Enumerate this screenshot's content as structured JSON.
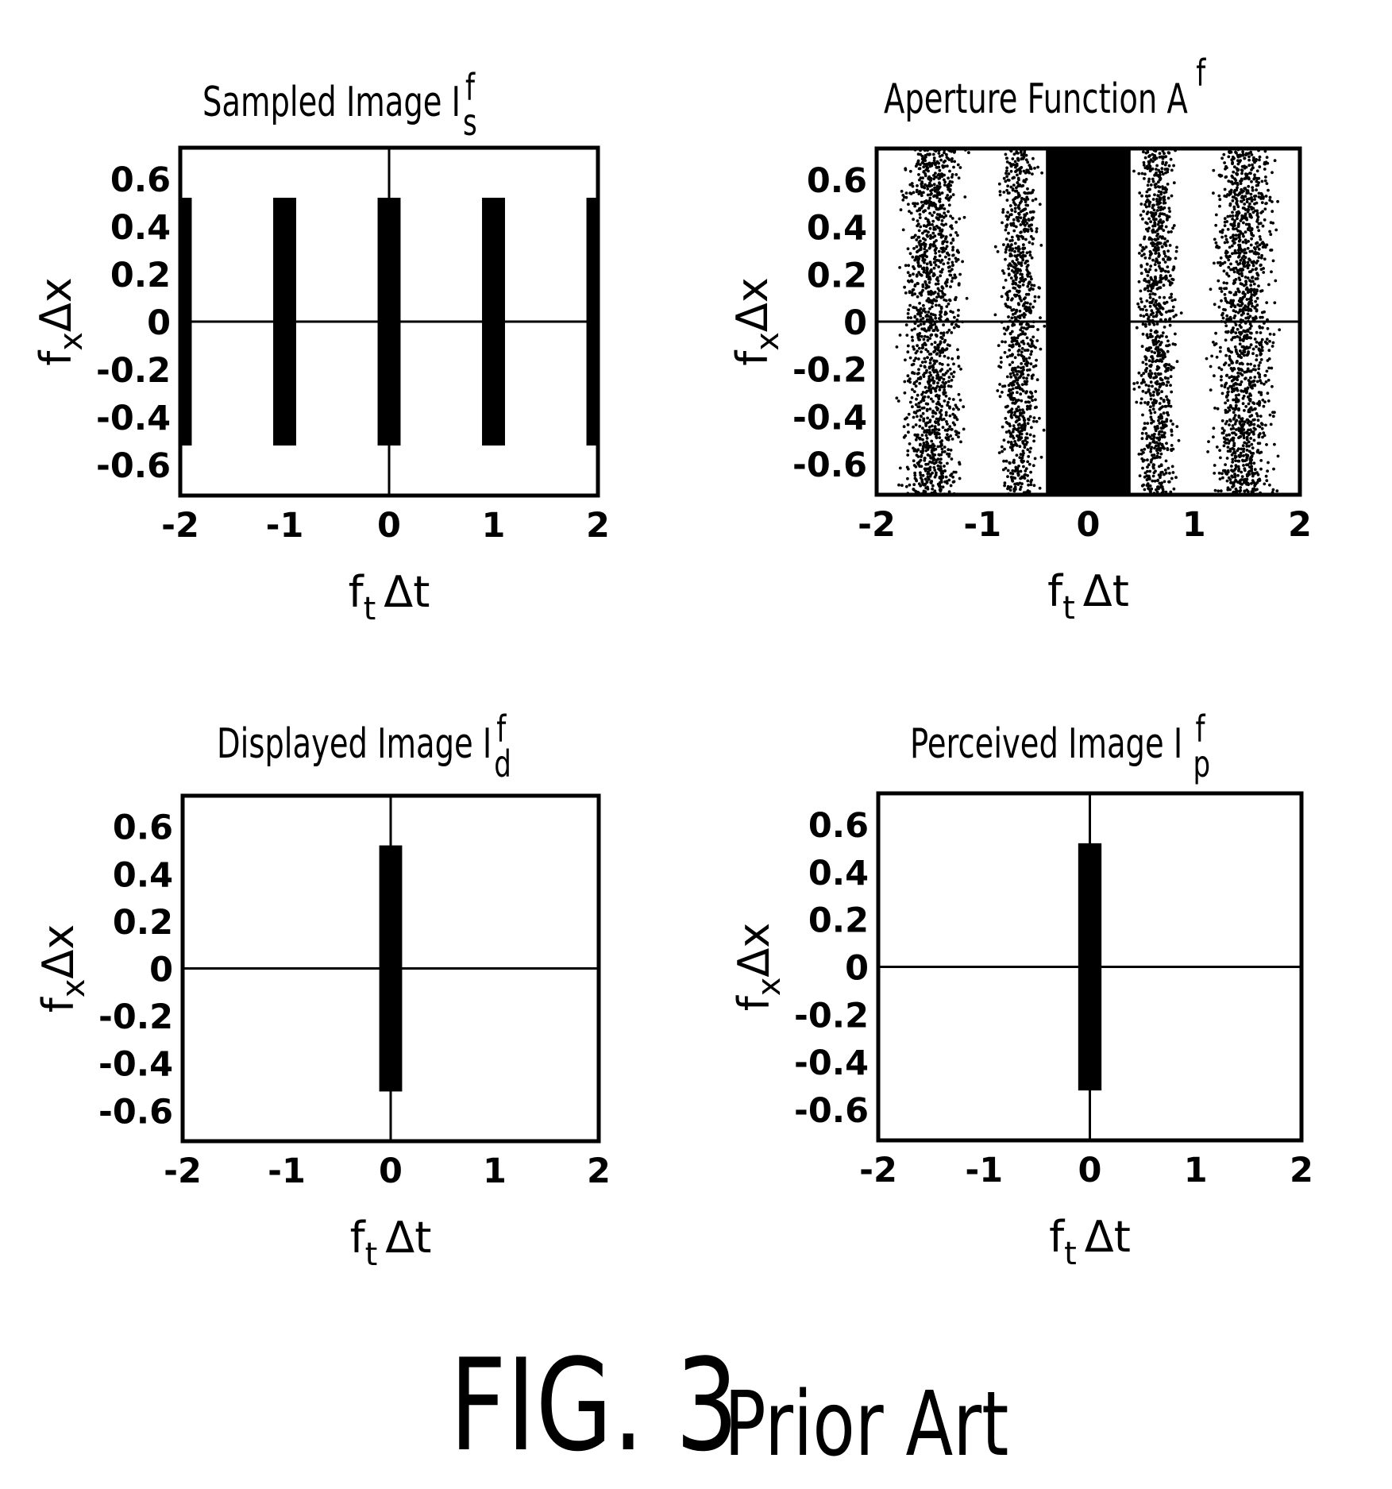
{
  "figure": {
    "caption_main": "FIG. 3",
    "caption_note": "Prior Art"
  },
  "chart_data": [
    {
      "id": "sampled",
      "type": "bar",
      "title": "Sampled Image I",
      "title_sup": "f",
      "title_sub": "s",
      "xlabel": "f",
      "xlabel_sub": "t",
      "xlabel_rest": "Δt",
      "ylabel": "f",
      "ylabel_sub": "x",
      "ylabel_rest": "Δx",
      "xlim": [
        -2,
        2
      ],
      "ylim": [
        -0.73,
        0.73
      ],
      "xticks": [
        "-2",
        "-1",
        "0",
        "1",
        "2"
      ],
      "yticks": [
        "0.6",
        "0.4",
        "0.2",
        "0",
        "-0.2",
        "-0.4",
        "-0.6"
      ],
      "axes_lines": true,
      "bars": [
        {
          "x_center": -2,
          "width": 0.22,
          "y_min": -0.52,
          "y_max": 0.52
        },
        {
          "x_center": -1,
          "width": 0.22,
          "y_min": -0.52,
          "y_max": 0.52
        },
        {
          "x_center": 0,
          "width": 0.22,
          "y_min": -0.52,
          "y_max": 0.52
        },
        {
          "x_center": 1,
          "width": 0.22,
          "y_min": -0.52,
          "y_max": 0.52
        },
        {
          "x_center": 2,
          "width": 0.22,
          "y_min": -0.52,
          "y_max": 0.52
        }
      ],
      "dotted_bands": [],
      "solid_bands": []
    },
    {
      "id": "aperture",
      "type": "heatmap",
      "title": "Aperture Function A",
      "title_sup": "f",
      "title_sub": "",
      "xlabel": "f",
      "xlabel_sub": "t",
      "xlabel_rest": "Δt",
      "ylabel": "f",
      "ylabel_sub": "x",
      "ylabel_rest": "Δx",
      "xlim": [
        -2,
        2
      ],
      "ylim": [
        -0.73,
        0.73
      ],
      "xticks": [
        "-2",
        "-1",
        "0",
        "1",
        "2"
      ],
      "yticks": [
        "0.6",
        "0.4",
        "0.2",
        "0",
        "-0.2",
        "-0.4",
        "-0.6"
      ],
      "axes_lines": false,
      "bars": [],
      "solid_bands": [
        {
          "x_min": -0.4,
          "x_max": 0.4
        }
      ],
      "dotted_bands": [
        {
          "x_min": -1.85,
          "x_max": -1.1
        },
        {
          "x_min": -0.9,
          "x_max": -0.4
        },
        {
          "x_min": 0.4,
          "x_max": 0.9
        },
        {
          "x_min": 1.1,
          "x_max": 1.85
        }
      ]
    },
    {
      "id": "displayed",
      "type": "bar",
      "title": "Displayed Image I",
      "title_sup": "f",
      "title_sub": "d",
      "xlabel": "f",
      "xlabel_sub": "t",
      "xlabel_rest": "Δt",
      "ylabel": "f",
      "ylabel_sub": "x",
      "ylabel_rest": "Δx",
      "xlim": [
        -2,
        2
      ],
      "ylim": [
        -0.73,
        0.73
      ],
      "xticks": [
        "-2",
        "-1",
        "0",
        "1",
        "2"
      ],
      "yticks": [
        "0.6",
        "0.4",
        "0.2",
        "0",
        "-0.2",
        "-0.4",
        "-0.6"
      ],
      "axes_lines": true,
      "bars": [
        {
          "x_center": 0,
          "width": 0.22,
          "y_min": -0.52,
          "y_max": 0.52
        }
      ],
      "dotted_bands": [],
      "solid_bands": []
    },
    {
      "id": "perceived",
      "type": "bar",
      "title": "Perceived Image I",
      "title_sup": "f",
      "title_sub": "p",
      "xlabel": "f",
      "xlabel_sub": "t",
      "xlabel_rest": "Δt",
      "ylabel": "f",
      "ylabel_sub": "x",
      "ylabel_rest": "Δx",
      "xlim": [
        -2,
        2
      ],
      "ylim": [
        -0.73,
        0.73
      ],
      "xticks": [
        "-2",
        "-1",
        "0",
        "1",
        "2"
      ],
      "yticks": [
        "0.6",
        "0.4",
        "0.2",
        "0",
        "-0.2",
        "-0.4",
        "-0.6"
      ],
      "axes_lines": true,
      "bars": [
        {
          "x_center": 0,
          "width": 0.22,
          "y_min": -0.52,
          "y_max": 0.52
        }
      ],
      "dotted_bands": [],
      "solid_bands": []
    }
  ]
}
